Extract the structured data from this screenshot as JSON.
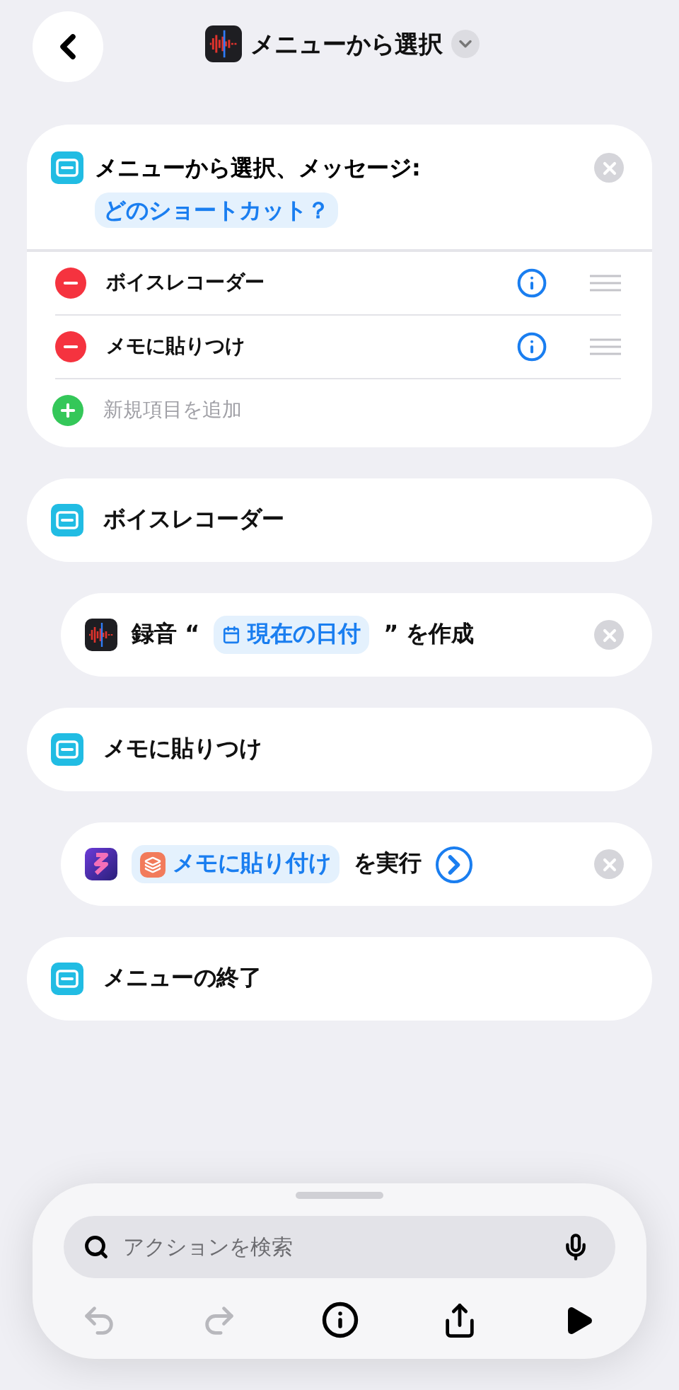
{
  "header": {
    "title": "メニューから選択"
  },
  "blocks": [
    {
      "kind": "menu",
      "title": "メニューから選択、メッセージ:",
      "prompt": "どのショートカット？",
      "items": [
        {
          "label": "ボイスレコーダー"
        },
        {
          "label": "メモに貼りつけ"
        }
      ],
      "add_label": "新規項目を追加"
    },
    {
      "kind": "case",
      "title": "ボイスレコーダー"
    },
    {
      "kind": "action",
      "parts": [
        {
          "kind": "text",
          "text": "録音 “"
        },
        {
          "kind": "date",
          "text": "現在の日付"
        },
        {
          "kind": "text",
          "text": "” を作成"
        }
      ],
      "go": false
    },
    {
      "kind": "case",
      "title": "メモに貼りつけ"
    },
    {
      "kind": "action",
      "parts": [
        {
          "kind": "shortcut",
          "text": "メモに貼り付け"
        },
        {
          "kind": "text",
          "text": "を実行"
        }
      ],
      "go": true
    },
    {
      "kind": "case",
      "title": "メニューの終了"
    }
  ],
  "search": {
    "placeholder": "アクションを検索"
  },
  "toolbar": [
    {
      "kind": "undo",
      "disabled": true
    },
    {
      "kind": "redo",
      "disabled": true
    },
    {
      "kind": "info",
      "disabled": false
    },
    {
      "kind": "share",
      "disabled": false
    },
    {
      "kind": "play",
      "disabled": false
    }
  ]
}
